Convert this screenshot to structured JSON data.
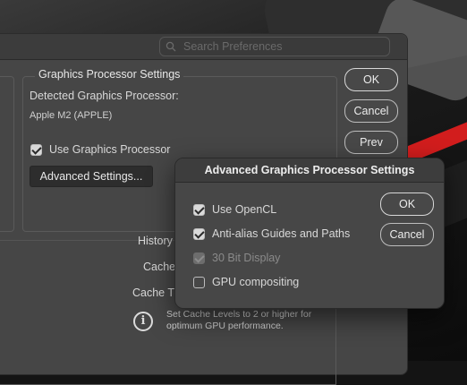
{
  "search": {
    "placeholder": "Search Preferences"
  },
  "prefs": {
    "group_title": "Graphics Processor Settings",
    "detected_label": "Detected Graphics Processor:",
    "detected_value": "Apple M2 (APPLE)",
    "use_gpu_label": "Use Graphics Processor",
    "use_gpu_checked": true,
    "advanced_button": "Advanced Settings...",
    "ok_button": "OK",
    "cancel_button": "Cancel",
    "prev_button": "Prev",
    "history_label": "History",
    "cache_label": "Cache",
    "cache_tiles_label": "Cache Ti",
    "info_text": "Set Cache Levels to 2 or higher for optimum GPU performance."
  },
  "dialog": {
    "title": "Advanced Graphics Processor Settings",
    "ok_button": "OK",
    "cancel_button": "Cancel",
    "options": [
      {
        "label": "Use OpenCL",
        "checked": true,
        "enabled": true
      },
      {
        "label": "Anti-alias Guides and Paths",
        "checked": true,
        "enabled": true
      },
      {
        "label": "30 Bit Display",
        "checked": true,
        "enabled": false
      },
      {
        "label": "GPU compositing",
        "checked": false,
        "enabled": true
      }
    ]
  },
  "colors": {
    "window_bg": "#464646",
    "dialog_bg": "#474747",
    "text": "#e8e8e8",
    "disabled_text": "#8a8a8a"
  }
}
